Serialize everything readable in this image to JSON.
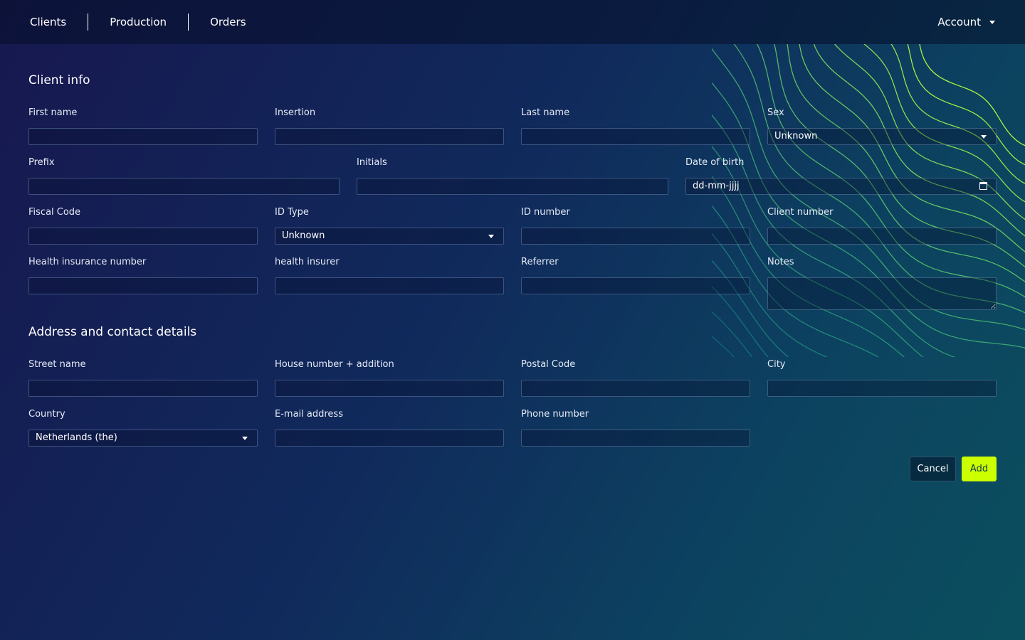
{
  "nav": {
    "items": [
      "Clients",
      "Production",
      "Orders"
    ],
    "account": "Account"
  },
  "colors": {
    "accent": "#ccff00",
    "background": "#102a5c"
  },
  "client_info": {
    "title": "Client info",
    "first_name": {
      "label": "First name",
      "value": ""
    },
    "insertion": {
      "label": "Insertion",
      "value": ""
    },
    "last_name": {
      "label": "Last name",
      "value": ""
    },
    "sex": {
      "label": "Sex",
      "selected": "Unknown"
    },
    "prefix": {
      "label": "Prefix",
      "value": ""
    },
    "initials": {
      "label": "Initials",
      "value": ""
    },
    "date_of_birth": {
      "label": "Date of birth",
      "placeholder": "dd-mm-jjjj"
    },
    "fiscal_code": {
      "label": "Fiscal Code",
      "value": ""
    },
    "id_type": {
      "label": "ID Type",
      "selected": "Unknown"
    },
    "id_number": {
      "label": "ID number",
      "value": ""
    },
    "client_number": {
      "label": "Client number",
      "value": ""
    },
    "health_insurance_number": {
      "label": "Health insurance number",
      "value": ""
    },
    "health_insurer": {
      "label": "health insurer",
      "value": ""
    },
    "referrer": {
      "label": "Referrer",
      "value": ""
    },
    "notes": {
      "label": "Notes",
      "value": ""
    }
  },
  "address": {
    "title": "Address and contact details",
    "street_name": {
      "label": "Street name",
      "value": ""
    },
    "house_number": {
      "label": "House number + addition",
      "value": ""
    },
    "postal_code": {
      "label": "Postal Code",
      "value": ""
    },
    "city": {
      "label": "City",
      "value": ""
    },
    "country": {
      "label": "Country",
      "selected": "Netherlands (the)"
    },
    "email": {
      "label": "E-mail address",
      "value": ""
    },
    "phone": {
      "label": "Phone number",
      "value": ""
    }
  },
  "actions": {
    "cancel": "Cancel",
    "add": "Add"
  }
}
